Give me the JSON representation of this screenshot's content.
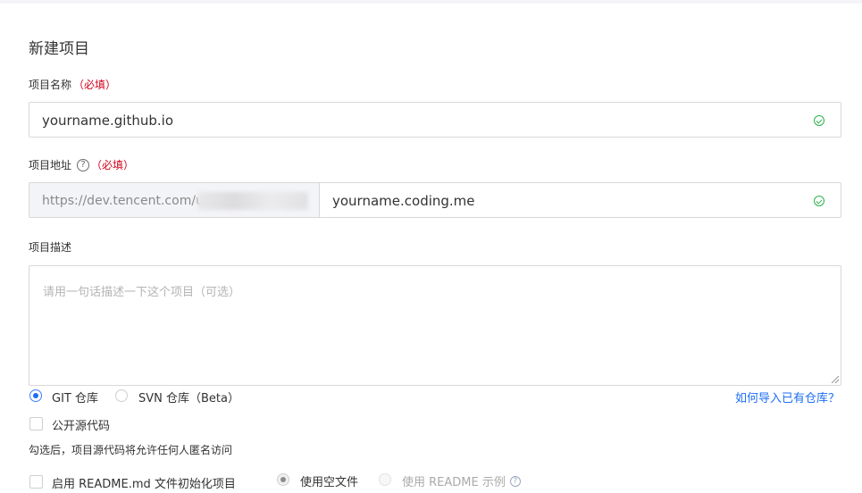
{
  "form": {
    "title": "新建项目",
    "name_field": {
      "label": "项目名称",
      "required": "（必填）",
      "value": "yourname.github.io",
      "status_icon": "check-circle-icon"
    },
    "address_field": {
      "label": "项目地址",
      "required": "（必填）",
      "help": "?",
      "prefix": "https://dev.tencent.com/u",
      "value": "yourname.coding.me",
      "status_icon": "check-circle-icon"
    },
    "description_field": {
      "label": "项目描述",
      "placeholder": "请用一句话描述一下这个项目（可选）",
      "value": ""
    },
    "repo_type": {
      "options": [
        {
          "label": "GIT 仓库",
          "selected": true
        },
        {
          "label": "SVN 仓库（Beta）",
          "selected": false
        }
      ],
      "import_link": "如何导入已有仓库？"
    },
    "public_source": {
      "label": "公开源代码",
      "checked": false,
      "hint": "勾选后，项目源代码将允许任何人匿名访问"
    },
    "readme_init": {
      "label": "启用 README.md 文件初始化项目",
      "checked": false,
      "options": [
        {
          "label": "使用空文件",
          "selected": true,
          "disabled": true
        },
        {
          "label": "使用 README 示例",
          "selected": false,
          "disabled": true
        }
      ],
      "help": "?"
    }
  },
  "colors": {
    "accent": "#1d6ef5",
    "required": "#d0021b",
    "success": "#2bb24c",
    "border": "#d8d8d8"
  }
}
